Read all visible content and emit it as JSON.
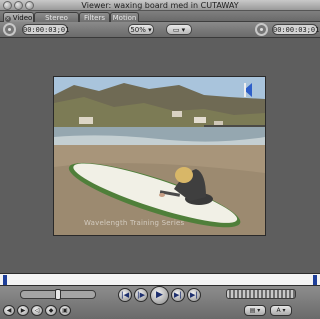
{
  "window": {
    "title": "Viewer: waxing board med in CUTAWAY"
  },
  "tabs": [
    {
      "label": "Video",
      "active": true
    },
    {
      "label": "Stereo (a1a2)",
      "active": false
    },
    {
      "label": "Filters",
      "active": false
    },
    {
      "label": "Motion",
      "active": false
    }
  ],
  "toolbar": {
    "duration_timecode": "00:00:03;01",
    "zoom_value": "50%",
    "view_popup": "",
    "current_timecode": "00:00:03;01"
  },
  "video": {
    "watermark": "Wavelength Training Series",
    "marker_icon": "in-point-marker-icon"
  },
  "colors": {
    "window_bg": "#646464",
    "scrubber_bg": "#f4f4f4",
    "marker_blue": "#1f3f9a"
  }
}
